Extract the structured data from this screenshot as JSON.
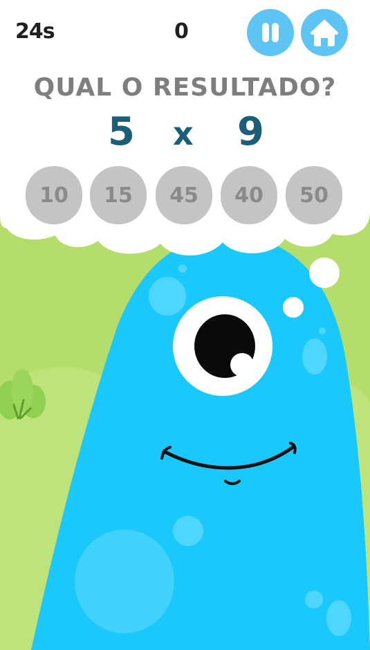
{
  "hud": {
    "timer": "24s",
    "score": "0"
  },
  "buttons": {
    "pause_icon": "pause-icon",
    "home_icon": "home-icon"
  },
  "question": {
    "prompt": "QUAL O RESULTADO?",
    "operand_a": "5",
    "operator": "x",
    "operand_b": "9"
  },
  "answers": [
    "10",
    "15",
    "45",
    "40",
    "50"
  ],
  "colors": {
    "background": "#b4dd6c",
    "monster": "#1ac8fb",
    "buttons": "#5ec4f4",
    "answer_bg": "#c4c4c4",
    "operand": "#1a5e78",
    "prompt": "#7e7e7e"
  }
}
